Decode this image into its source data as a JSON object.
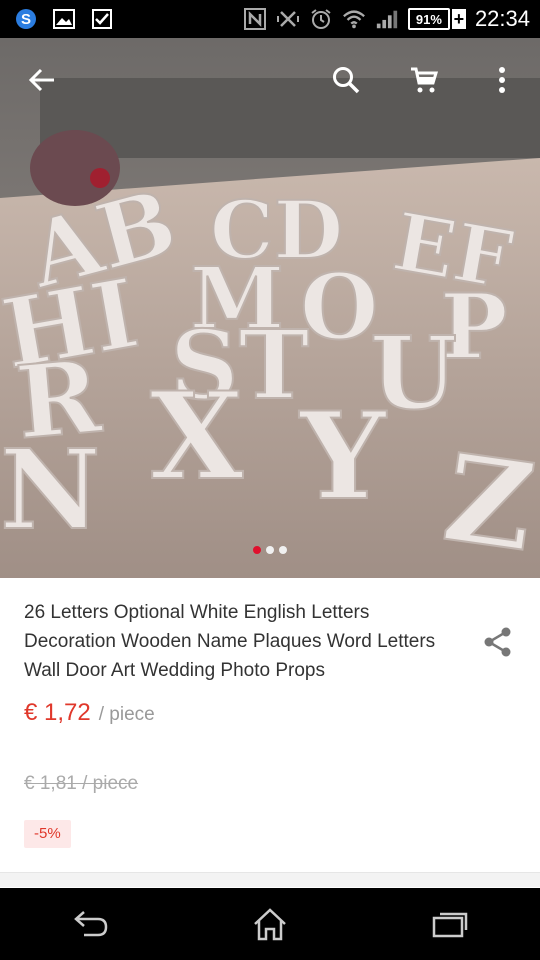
{
  "status_bar": {
    "time": "22:34",
    "battery": "91%",
    "icons": [
      "s-app-icon",
      "gallery-icon",
      "checkbox-icon",
      "nfc-icon",
      "vibrate-icon",
      "alarm-icon",
      "wifi-icon",
      "signal-icon",
      "battery-icon"
    ]
  },
  "toolbar": {
    "icons": [
      "back-arrow-icon",
      "search-icon",
      "cart-icon",
      "more-vert-icon"
    ]
  },
  "gallery": {
    "slide_count": 3,
    "active_slide": 0,
    "accent_color": "#e0102d"
  },
  "product": {
    "title": "26 Letters Optional White English Letters Decoration Wooden Name Plaques Word Letters Wall Door Art Wedding Photo Props",
    "price": "€ 1,72",
    "price_unit": "/ piece",
    "original_price": "€ 1,81 / piece",
    "discount": "-5%",
    "price_color": "#e0382b"
  },
  "nav_bar": {
    "icons": [
      "back-nav-icon",
      "home-nav-icon",
      "recents-nav-icon"
    ]
  }
}
